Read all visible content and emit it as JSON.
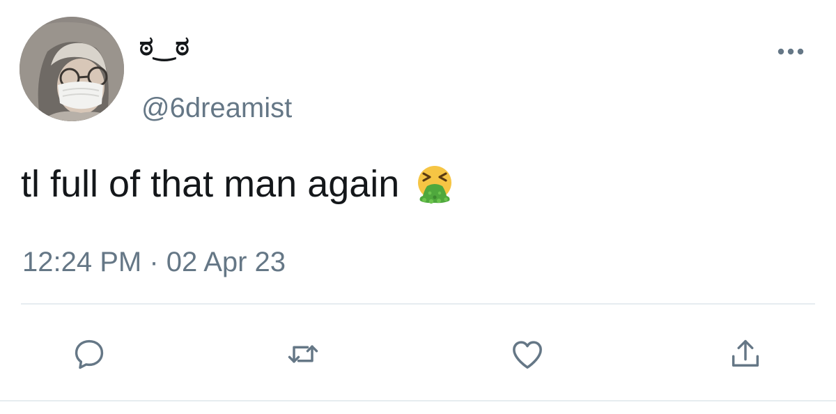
{
  "tweet": {
    "display_name": "ಠ‿ಠ",
    "handle": "@6dreamist",
    "text": "tl full of that man again",
    "emoji": "face-vomiting",
    "time": "12:24 PM",
    "separator": "·",
    "date": "02 Apr 23"
  },
  "icons": {
    "more": "more-horizontal-icon",
    "reply": "reply-icon",
    "retweet": "retweet-icon",
    "like": "heart-icon",
    "share": "share-icon"
  },
  "colors": {
    "text_primary": "#14171a",
    "text_secondary": "#657786",
    "icon": "#657786",
    "divider": "#e6ecf0"
  }
}
